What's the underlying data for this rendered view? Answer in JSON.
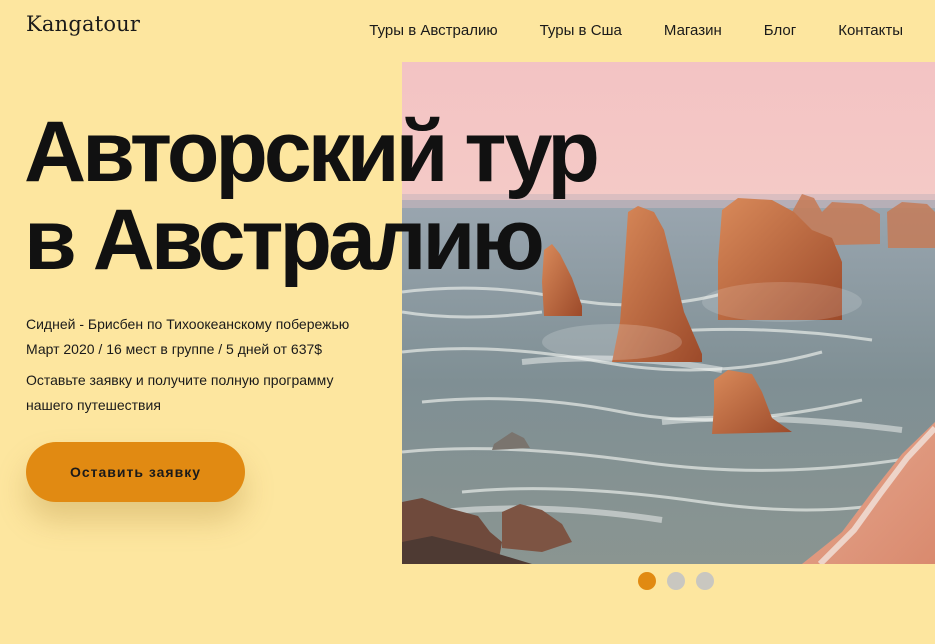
{
  "brand": {
    "logo": "Kangatour"
  },
  "nav": {
    "items": [
      {
        "label": "Туры в Австралию"
      },
      {
        "label": "Туры в Сша"
      },
      {
        "label": "Магазин"
      },
      {
        "label": "Блог"
      },
      {
        "label": "Контакты"
      }
    ]
  },
  "hero": {
    "title_line1": "Авторский тур",
    "title_line2": "в Австралию",
    "route": "Сидней - Брисбен по Тихоокеанскому побережью",
    "details": "Март 2020 / 16 мест в группе / 5 дней от 637$",
    "invite_line1": "Оставьте заявку и получите полную программу",
    "invite_line2": "нашего путешествия",
    "cta_label": "Оставить заявку"
  },
  "slider": {
    "slide_count": 3,
    "active_index": 0
  },
  "colors": {
    "background": "#fde69f",
    "accent": "#e18a12",
    "inactive_dot": "#c9c7c0"
  }
}
